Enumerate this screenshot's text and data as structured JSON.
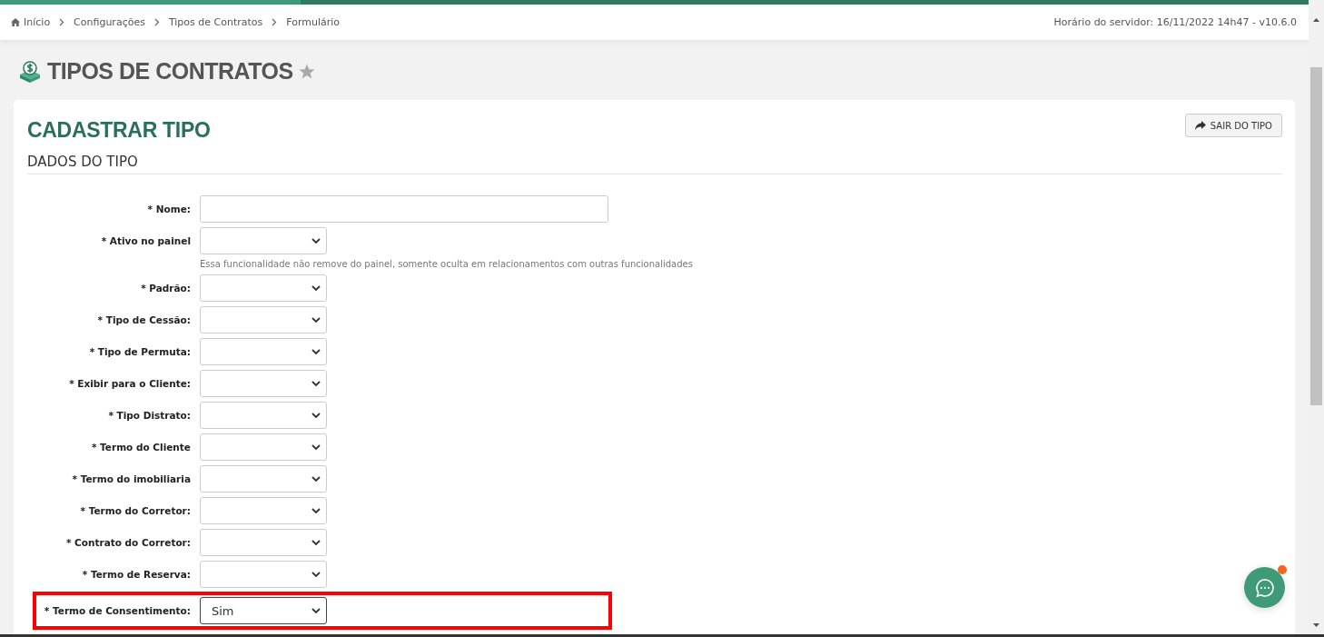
{
  "breadcrumb": [
    {
      "label": "Início",
      "kind": "home"
    },
    {
      "label": "Configurações",
      "kind": "link"
    },
    {
      "label": "Tipos de Contratos",
      "kind": "link"
    },
    {
      "label": "Formulário",
      "kind": "current"
    }
  ],
  "server_info": "Horário do servidor: 16/11/2022 14h47 - v10.6.0",
  "page_title": "TIPOS DE CONTRATOS",
  "favorite": false,
  "form": {
    "title": "CADASTRAR TIPO",
    "exit_button": "SAIR DO TIPO",
    "section": "DADOS DO TIPO",
    "fields": [
      {
        "label": "* Nome:",
        "kind": "text",
        "highlighted": false
      },
      {
        "label": "* Ativo no painel",
        "kind": "select",
        "highlighted": false,
        "help": "Essa funcionalidade não remove do painel, somente oculta em relacionamentos com outras funcionalidades"
      },
      {
        "label": "* Padrão:",
        "kind": "select",
        "highlighted": false
      },
      {
        "label": "* Tipo de Cessão:",
        "kind": "select",
        "highlighted": false
      },
      {
        "label": "* Tipo de Permuta:",
        "kind": "select",
        "highlighted": false
      },
      {
        "label": "* Exibir para o Cliente:",
        "kind": "select",
        "highlighted": false
      },
      {
        "label": "* Tipo Distrato:",
        "kind": "select",
        "highlighted": false
      },
      {
        "label": "* Termo do Cliente",
        "kind": "select",
        "highlighted": false
      },
      {
        "label": "* Termo do imobiliaria",
        "kind": "select",
        "highlighted": false
      },
      {
        "label": "* Termo do Corretor:",
        "kind": "select",
        "highlighted": false
      },
      {
        "label": "* Contrato do Corretor:",
        "kind": "select",
        "highlighted": false
      },
      {
        "label": "* Termo de Reserva:",
        "kind": "select",
        "highlighted": false
      },
      {
        "label": "* Termo de Consentimento:",
        "kind": "select",
        "highlighted": true,
        "value": "Sim"
      }
    ]
  },
  "chat": {
    "unread": true
  }
}
